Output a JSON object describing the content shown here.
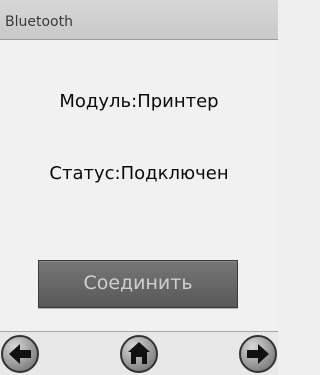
{
  "window": {
    "title": "Bluetooth"
  },
  "info": {
    "module_text": "Модуль:Принтер",
    "status_text": "Статус:Подключен"
  },
  "actions": {
    "connect_label": "Соединить"
  },
  "navigation": {
    "back_icon": "arrow-left-icon",
    "home_icon": "home-icon",
    "forward_icon": "arrow-right-icon"
  }
}
